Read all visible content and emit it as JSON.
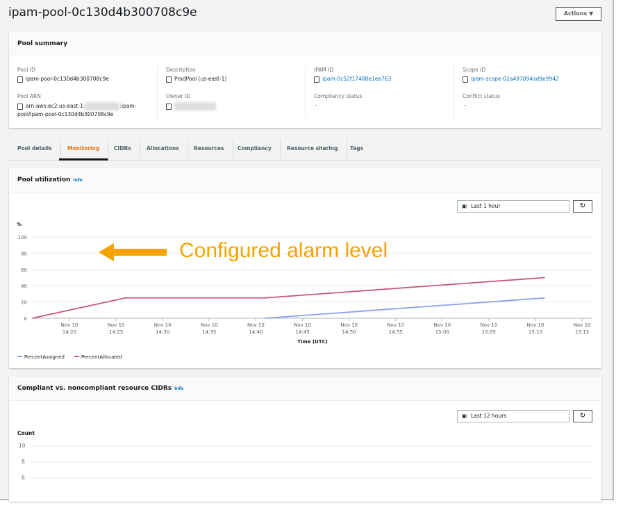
{
  "title": "ipam-pool-0c130d4b300708c9e",
  "actions_label": "Actions ▼",
  "summary": {
    "heading": "Pool summary",
    "pool_id_label": "Pool ID",
    "pool_id": "ipam-pool-0c130d4b300708c9e",
    "description_label": "Description",
    "description": "ProdPool (us-east-1)",
    "ipam_id_label": "IPAM ID",
    "ipam_id": "ipam-0c52f17488e1ea763",
    "scope_id_label": "Scope ID",
    "scope_id": "ipam-scope-02a497094ad9e9942",
    "pool_arn_label": "Pool ARN",
    "pool_arn_prefix": "arn:aws:ec2:us-east-1:",
    "pool_arn_mid": ":ipam-",
    "pool_arn_suffix": "pool/ipam-pool-0c130d4b300708c9e",
    "owner_id_label": "Owner ID",
    "compliancy_label": "Compliancy status",
    "compliancy": "-",
    "conflict_label": "Conflict status",
    "conflict": "-"
  },
  "tabs": [
    "Pool details",
    "Monitoring",
    "CIDRs",
    "Allocations",
    "Resources",
    "Compliancy",
    "Resource sharing",
    "Tags"
  ],
  "active_tab": "Monitoring",
  "utilization": {
    "heading": "Pool utilization",
    "info": "Info",
    "range": "Last 1 hour",
    "annotation": "Configured alarm level"
  },
  "compliance": {
    "heading": "Compliant vs. noncompliant resource CIDRs",
    "info": "Info",
    "range": "Last 12 hours",
    "ylabel": "Count",
    "yticks": [
      "10",
      "8",
      "6"
    ]
  },
  "chart_data": {
    "type": "line",
    "ylabel": "%",
    "xlabel": "Time (UTC)",
    "ylim": [
      0,
      100
    ],
    "yticks": [
      0,
      20,
      40,
      60,
      80,
      100
    ],
    "xticks": [
      "Nov 10 14:20",
      "Nov 10 14:25",
      "Nov 10 14:30",
      "Nov 10 14:35",
      "Nov 10 14:40",
      "Nov 10 14:45",
      "Nov 10 14:50",
      "Nov 10 14:55",
      "Nov 10 15:00",
      "Nov 10 15:05",
      "Nov 10 15:10",
      "Nov 10 15:15"
    ],
    "grid": true,
    "legend": "bottom-left",
    "series": [
      {
        "name": "PercentAssigned",
        "color": "#8c9ef0",
        "points": [
          [
            "14:41",
            0
          ],
          [
            "15:11",
            25
          ]
        ]
      },
      {
        "name": "PercentAllocated",
        "color": "#c9577a",
        "points": [
          [
            "14:16",
            0
          ],
          [
            "14:26",
            25
          ],
          [
            "14:41",
            25
          ],
          [
            "15:11",
            50
          ]
        ]
      }
    ]
  },
  "colors": {
    "accent": "#ec7211",
    "link": "#0073bb",
    "annotation": "#f5a300"
  }
}
